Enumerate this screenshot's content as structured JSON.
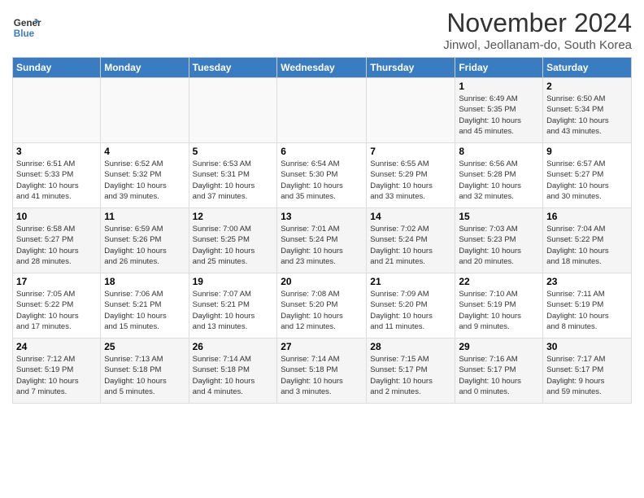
{
  "logo": {
    "line1": "General",
    "line2": "Blue"
  },
  "title": "November 2024",
  "location": "Jinwol, Jeollanam-do, South Korea",
  "days_of_week": [
    "Sunday",
    "Monday",
    "Tuesday",
    "Wednesday",
    "Thursday",
    "Friday",
    "Saturday"
  ],
  "weeks": [
    [
      {
        "day": "",
        "info": ""
      },
      {
        "day": "",
        "info": ""
      },
      {
        "day": "",
        "info": ""
      },
      {
        "day": "",
        "info": ""
      },
      {
        "day": "",
        "info": ""
      },
      {
        "day": "1",
        "info": "Sunrise: 6:49 AM\nSunset: 5:35 PM\nDaylight: 10 hours\nand 45 minutes."
      },
      {
        "day": "2",
        "info": "Sunrise: 6:50 AM\nSunset: 5:34 PM\nDaylight: 10 hours\nand 43 minutes."
      }
    ],
    [
      {
        "day": "3",
        "info": "Sunrise: 6:51 AM\nSunset: 5:33 PM\nDaylight: 10 hours\nand 41 minutes."
      },
      {
        "day": "4",
        "info": "Sunrise: 6:52 AM\nSunset: 5:32 PM\nDaylight: 10 hours\nand 39 minutes."
      },
      {
        "day": "5",
        "info": "Sunrise: 6:53 AM\nSunset: 5:31 PM\nDaylight: 10 hours\nand 37 minutes."
      },
      {
        "day": "6",
        "info": "Sunrise: 6:54 AM\nSunset: 5:30 PM\nDaylight: 10 hours\nand 35 minutes."
      },
      {
        "day": "7",
        "info": "Sunrise: 6:55 AM\nSunset: 5:29 PM\nDaylight: 10 hours\nand 33 minutes."
      },
      {
        "day": "8",
        "info": "Sunrise: 6:56 AM\nSunset: 5:28 PM\nDaylight: 10 hours\nand 32 minutes."
      },
      {
        "day": "9",
        "info": "Sunrise: 6:57 AM\nSunset: 5:27 PM\nDaylight: 10 hours\nand 30 minutes."
      }
    ],
    [
      {
        "day": "10",
        "info": "Sunrise: 6:58 AM\nSunset: 5:27 PM\nDaylight: 10 hours\nand 28 minutes."
      },
      {
        "day": "11",
        "info": "Sunrise: 6:59 AM\nSunset: 5:26 PM\nDaylight: 10 hours\nand 26 minutes."
      },
      {
        "day": "12",
        "info": "Sunrise: 7:00 AM\nSunset: 5:25 PM\nDaylight: 10 hours\nand 25 minutes."
      },
      {
        "day": "13",
        "info": "Sunrise: 7:01 AM\nSunset: 5:24 PM\nDaylight: 10 hours\nand 23 minutes."
      },
      {
        "day": "14",
        "info": "Sunrise: 7:02 AM\nSunset: 5:24 PM\nDaylight: 10 hours\nand 21 minutes."
      },
      {
        "day": "15",
        "info": "Sunrise: 7:03 AM\nSunset: 5:23 PM\nDaylight: 10 hours\nand 20 minutes."
      },
      {
        "day": "16",
        "info": "Sunrise: 7:04 AM\nSunset: 5:22 PM\nDaylight: 10 hours\nand 18 minutes."
      }
    ],
    [
      {
        "day": "17",
        "info": "Sunrise: 7:05 AM\nSunset: 5:22 PM\nDaylight: 10 hours\nand 17 minutes."
      },
      {
        "day": "18",
        "info": "Sunrise: 7:06 AM\nSunset: 5:21 PM\nDaylight: 10 hours\nand 15 minutes."
      },
      {
        "day": "19",
        "info": "Sunrise: 7:07 AM\nSunset: 5:21 PM\nDaylight: 10 hours\nand 13 minutes."
      },
      {
        "day": "20",
        "info": "Sunrise: 7:08 AM\nSunset: 5:20 PM\nDaylight: 10 hours\nand 12 minutes."
      },
      {
        "day": "21",
        "info": "Sunrise: 7:09 AM\nSunset: 5:20 PM\nDaylight: 10 hours\nand 11 minutes."
      },
      {
        "day": "22",
        "info": "Sunrise: 7:10 AM\nSunset: 5:19 PM\nDaylight: 10 hours\nand 9 minutes."
      },
      {
        "day": "23",
        "info": "Sunrise: 7:11 AM\nSunset: 5:19 PM\nDaylight: 10 hours\nand 8 minutes."
      }
    ],
    [
      {
        "day": "24",
        "info": "Sunrise: 7:12 AM\nSunset: 5:19 PM\nDaylight: 10 hours\nand 7 minutes."
      },
      {
        "day": "25",
        "info": "Sunrise: 7:13 AM\nSunset: 5:18 PM\nDaylight: 10 hours\nand 5 minutes."
      },
      {
        "day": "26",
        "info": "Sunrise: 7:14 AM\nSunset: 5:18 PM\nDaylight: 10 hours\nand 4 minutes."
      },
      {
        "day": "27",
        "info": "Sunrise: 7:14 AM\nSunset: 5:18 PM\nDaylight: 10 hours\nand 3 minutes."
      },
      {
        "day": "28",
        "info": "Sunrise: 7:15 AM\nSunset: 5:17 PM\nDaylight: 10 hours\nand 2 minutes."
      },
      {
        "day": "29",
        "info": "Sunrise: 7:16 AM\nSunset: 5:17 PM\nDaylight: 10 hours\nand 0 minutes."
      },
      {
        "day": "30",
        "info": "Sunrise: 7:17 AM\nSunset: 5:17 PM\nDaylight: 9 hours\nand 59 minutes."
      }
    ]
  ]
}
